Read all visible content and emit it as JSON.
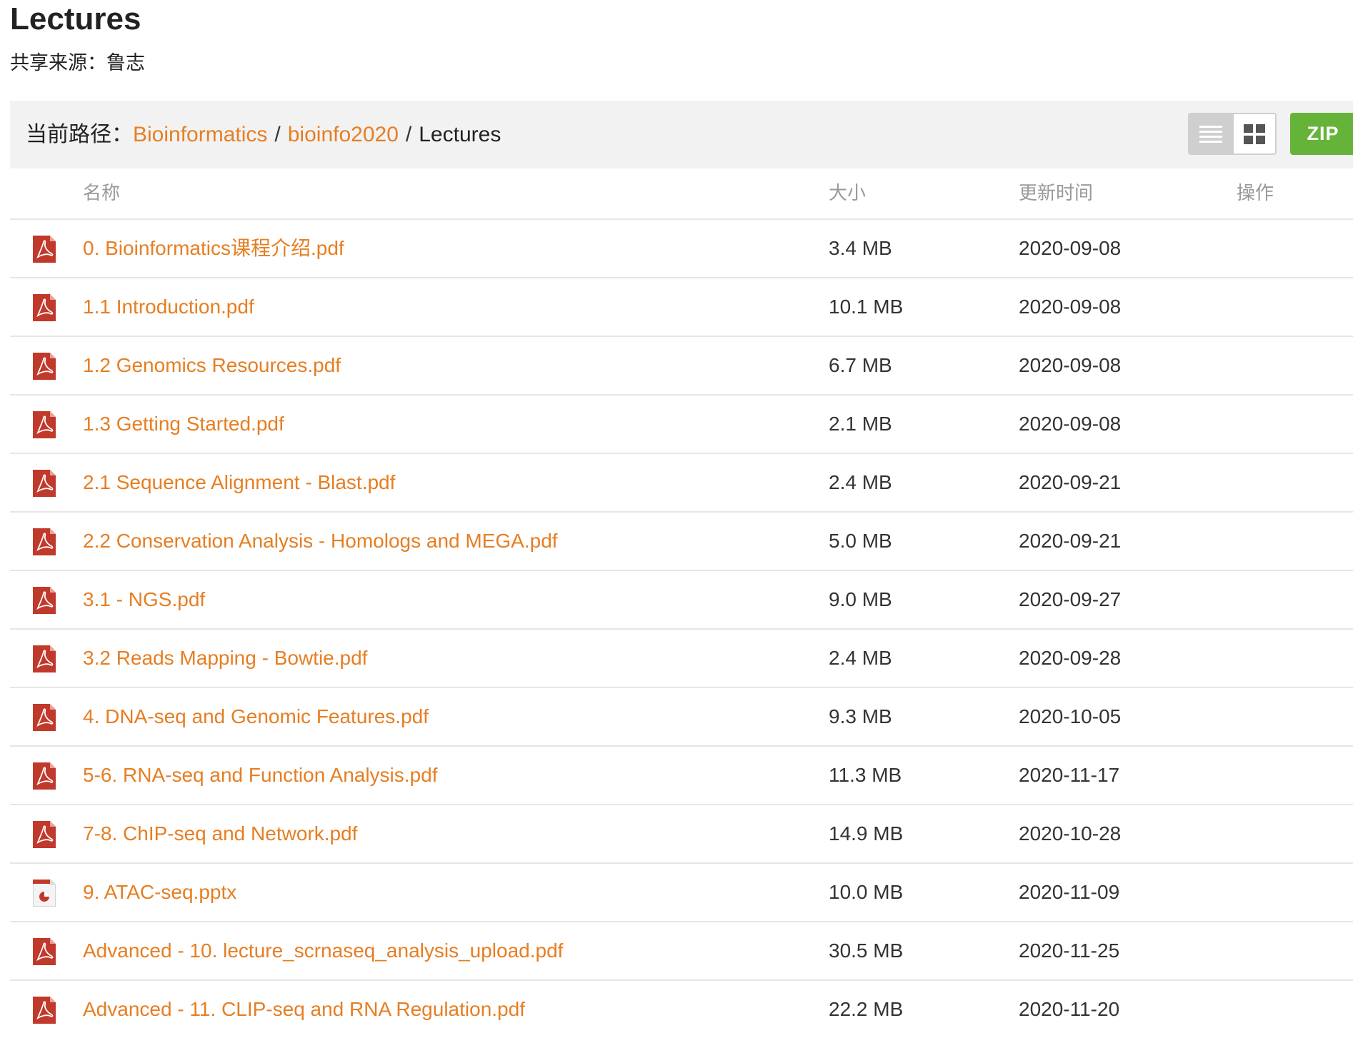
{
  "page": {
    "title": "Lectures",
    "share_source": "共享来源：鲁志"
  },
  "path": {
    "label": "当前路径：",
    "crumbs": [
      "Bioinformatics",
      "bioinfo2020"
    ],
    "separator": "/",
    "current": "Lectures"
  },
  "toolbar": {
    "list_view_icon": "list-view-icon",
    "grid_view_icon": "grid-view-icon",
    "active_view": "list",
    "zip_label": "ZIP"
  },
  "colors": {
    "accent": "#e67e22",
    "zip_green": "#66b33a",
    "pdf_red": "#c0392b",
    "header_bg": "#f2f2f2"
  },
  "table": {
    "headers": {
      "name": "名称",
      "size": "大小",
      "date": "更新时间",
      "ops": "操作"
    },
    "rows": [
      {
        "icon": "pdf-file-icon",
        "name": "0. Bioinformatics课程介绍.pdf",
        "size": "3.4 MB",
        "date": "2020-09-08"
      },
      {
        "icon": "pdf-file-icon",
        "name": "1.1 Introduction.pdf",
        "size": "10.1 MB",
        "date": "2020-09-08"
      },
      {
        "icon": "pdf-file-icon",
        "name": "1.2 Genomics Resources.pdf",
        "size": "6.7 MB",
        "date": "2020-09-08"
      },
      {
        "icon": "pdf-file-icon",
        "name": "1.3 Getting Started.pdf",
        "size": "2.1 MB",
        "date": "2020-09-08"
      },
      {
        "icon": "pdf-file-icon",
        "name": "2.1 Sequence Alignment - Blast.pdf",
        "size": "2.4 MB",
        "date": "2020-09-21"
      },
      {
        "icon": "pdf-file-icon",
        "name": "2.2 Conservation Analysis - Homologs and MEGA.pdf",
        "size": "5.0 MB",
        "date": "2020-09-21"
      },
      {
        "icon": "pdf-file-icon",
        "name": "3.1 - NGS.pdf",
        "size": "9.0 MB",
        "date": "2020-09-27"
      },
      {
        "icon": "pdf-file-icon",
        "name": "3.2 Reads Mapping - Bowtie.pdf",
        "size": "2.4 MB",
        "date": "2020-09-28"
      },
      {
        "icon": "pdf-file-icon",
        "name": "4. DNA-seq and Genomic Features.pdf",
        "size": "9.3 MB",
        "date": "2020-10-05"
      },
      {
        "icon": "pdf-file-icon",
        "name": "5-6. RNA-seq and Function Analysis.pdf",
        "size": "11.3 MB",
        "date": "2020-11-17"
      },
      {
        "icon": "pdf-file-icon",
        "name": "7-8. ChIP-seq and Network.pdf",
        "size": "14.9 MB",
        "date": "2020-10-28"
      },
      {
        "icon": "pptx-file-icon",
        "name": "9. ATAC-seq.pptx",
        "size": "10.0 MB",
        "date": "2020-11-09"
      },
      {
        "icon": "pdf-file-icon",
        "name": "Advanced - 10. lecture_scrnaseq_analysis_upload.pdf",
        "size": "30.5 MB",
        "date": "2020-11-25"
      },
      {
        "icon": "pdf-file-icon",
        "name": "Advanced - 11. CLIP-seq and RNA Regulation.pdf",
        "size": "22.2 MB",
        "date": "2020-11-20"
      }
    ]
  }
}
